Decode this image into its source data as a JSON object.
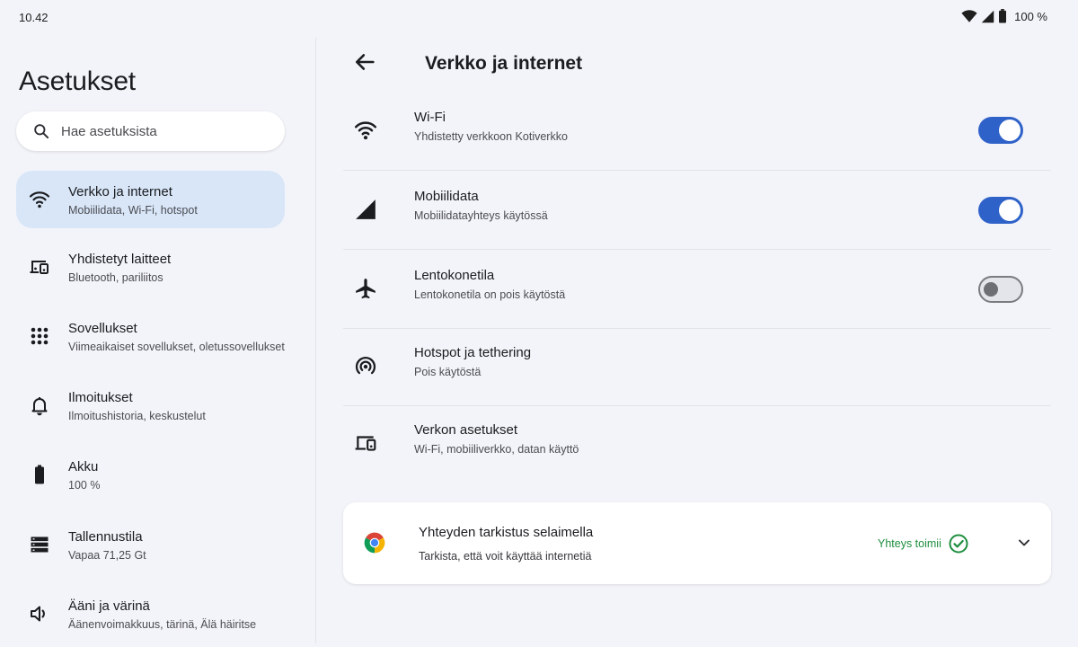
{
  "status_bar": {
    "time": "10.42",
    "battery_text": "100 %"
  },
  "left_pane": {
    "title": "Asetukset",
    "search": {
      "placeholder": "Hae asetuksista"
    },
    "items": [
      {
        "label": "Verkko ja internet",
        "sub": "Mobiilidata, Wi-Fi, hotspot",
        "icon": "wifi-icon",
        "selected": true
      },
      {
        "label": "Yhdistetyt laitteet",
        "sub": "Bluetooth, pariliitos",
        "icon": "connected-devices-icon"
      },
      {
        "label": "Sovellukset",
        "sub": "Viimeaikaiset sovellukset, oletussovellukset",
        "icon": "apps-grid-icon"
      },
      {
        "label": "Ilmoitukset",
        "sub": "Ilmoitushistoria, keskustelut",
        "icon": "bell-icon"
      },
      {
        "label": "Akku",
        "sub": "100 %",
        "icon": "battery-icon"
      },
      {
        "label": "Tallennustila",
        "sub": "Vapaa 71,25 Gt",
        "icon": "storage-icon"
      },
      {
        "label": "Ääni ja värinä",
        "sub": "Äänenvoimakkuus, tärinä, Älä häiritse",
        "icon": "volume-icon"
      }
    ]
  },
  "right_pane": {
    "title": "Verkko ja internet",
    "rows": [
      {
        "label": "Wi-Fi",
        "sub": "Yhdistetty verkkoon Kotiverkko",
        "icon": "wifi-icon",
        "toggle": "on"
      },
      {
        "label": "Mobiilidata",
        "sub": "Mobiilidatayhteys käytössä",
        "icon": "cellular-signal-icon",
        "toggle": "on"
      },
      {
        "label": "Lentokonetila",
        "sub": "Lentokonetila on pois käytöstä",
        "icon": "airplane-icon",
        "toggle": "off"
      },
      {
        "label": "Hotspot ja tethering",
        "sub": "Pois käytöstä",
        "icon": "hotspot-icon"
      },
      {
        "label": "Verkon asetukset",
        "sub": "Wi-Fi, mobiiliverkko, datan käyttö",
        "icon": "network-settings-icon"
      }
    ],
    "card": {
      "label": "Yhteyden tarkistus selaimella",
      "sub": "Tarkista, että voit käyttää internetiä",
      "status": "Yhteys toimii",
      "icon": "chrome-icon"
    }
  },
  "colors": {
    "accent": "#2f62c9",
    "selected_bg": "#d8e6f8",
    "ok_green": "#1e8e3e",
    "background": "#f3f4f9"
  }
}
